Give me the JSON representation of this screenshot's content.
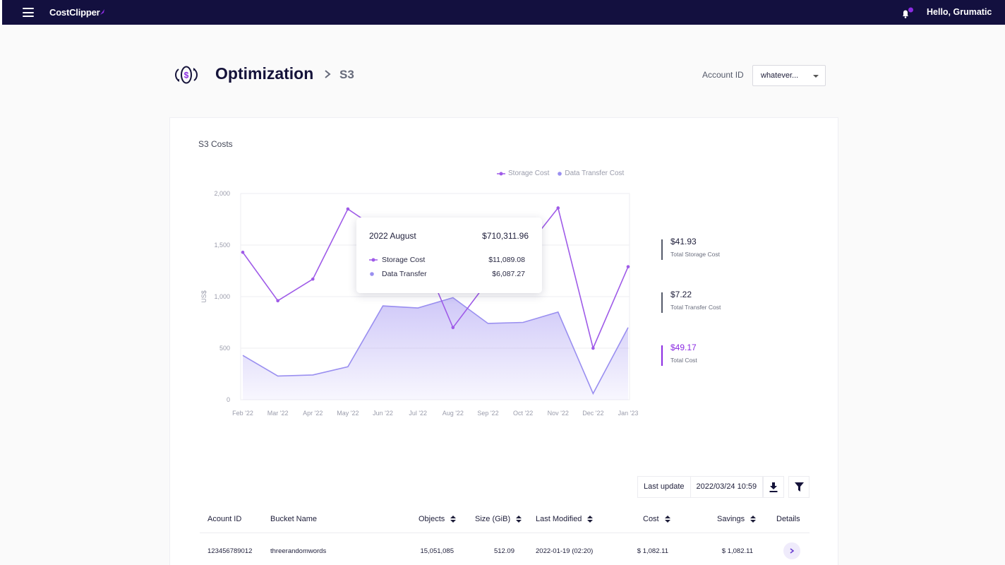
{
  "app": {
    "brand": "CostClipper",
    "greeting": "Hello, Grumatic"
  },
  "page": {
    "title": "Optimization",
    "crumb": "S3"
  },
  "account": {
    "label": "Account ID",
    "selected": "whatever..."
  },
  "chart_card": {
    "title": "S3 Costs"
  },
  "chart_data": {
    "type": "line",
    "title": "S3 Costs",
    "ylabel": "US$",
    "ylim": [
      0,
      2000
    ],
    "yticks": [
      0,
      500,
      1000,
      1500,
      2000
    ],
    "ytick_labels": [
      "0",
      "500",
      "1,000",
      "1,500",
      "2,000"
    ],
    "categories": [
      "Feb '22",
      "Mar '22",
      "Apr '22",
      "May '22",
      "Jun '22",
      "Jul '22",
      "Aug '22",
      "Sep '22",
      "Oct '22",
      "Nov '22",
      "Dec '22",
      "Jan '23"
    ],
    "series": [
      {
        "name": "Storage Cost",
        "style": "line",
        "color": "#9f5be8",
        "values": [
          1430,
          960,
          1170,
          1850,
          1620,
          1500,
          700,
          1150,
          1430,
          1860,
          500,
          1290
        ]
      },
      {
        "name": "Data Transfer Cost",
        "style": "area",
        "color": "#9a8ff0",
        "values": [
          430,
          230,
          240,
          320,
          910,
          890,
          990,
          740,
          750,
          850,
          60,
          700
        ]
      }
    ],
    "legend_position": "top-right",
    "grid": true
  },
  "tooltip": {
    "title": "2022 August",
    "total": "$710,311.96",
    "rows": [
      {
        "label": "Storage Cost",
        "value": "$11,089.08"
      },
      {
        "label": "Data Transfer",
        "value": "$6,087.27"
      }
    ]
  },
  "summary": [
    {
      "amount": "$41.93",
      "caption": "Total Storage Cost"
    },
    {
      "amount": "$7.22",
      "caption": "Total Transfer Cost"
    },
    {
      "amount": "$49.17",
      "caption": "Total Cost"
    }
  ],
  "table": {
    "last_update_label": "Last update",
    "last_update_value": "2022/03/24  10:59",
    "columns": {
      "account": "Acount ID",
      "bucket": "Bucket Name",
      "objects": "Objects",
      "size": "Size (GiB)",
      "modified": "Last Modified",
      "cost": "Cost",
      "savings": "Savings",
      "details": "Details"
    },
    "rows": [
      {
        "account": "123456789012",
        "bucket": "threerandomwords",
        "objects": "15,051,085",
        "size": "512.09",
        "modified": "2022-01-19 (02:20)",
        "cost": "$ 1,082.11",
        "savings": "$ 1,082.11"
      }
    ]
  },
  "colors": {
    "topbar": "#13103f",
    "accent": "#8b2be2",
    "storage": "#9f5be8",
    "transfer": "#9a8ff0"
  }
}
